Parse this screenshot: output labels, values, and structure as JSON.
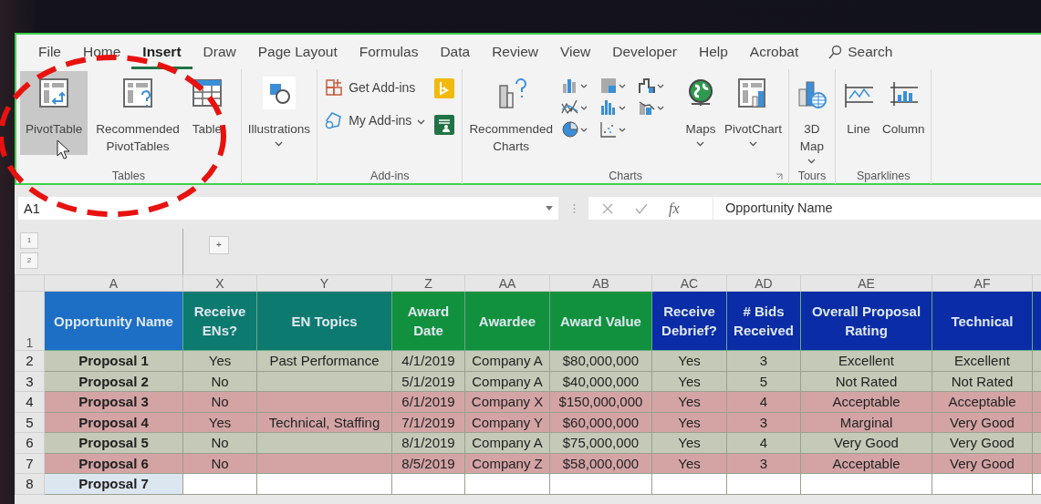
{
  "ribbon": {
    "tabs": [
      {
        "label": "File",
        "selected": false
      },
      {
        "label": "Home",
        "selected": false
      },
      {
        "label": "Insert",
        "selected": true
      },
      {
        "label": "Draw",
        "selected": false
      },
      {
        "label": "Page Layout",
        "selected": false
      },
      {
        "label": "Formulas",
        "selected": false
      },
      {
        "label": "Data",
        "selected": false
      },
      {
        "label": "Review",
        "selected": false
      },
      {
        "label": "View",
        "selected": false
      },
      {
        "label": "Developer",
        "selected": false
      },
      {
        "label": "Help",
        "selected": false
      },
      {
        "label": "Acrobat",
        "selected": false
      }
    ],
    "search": {
      "label": "Search"
    },
    "groups": [
      {
        "label": "Tables",
        "launcher": false,
        "items": [
          {
            "kind": "large",
            "label": "PivotTable",
            "hovered": true,
            "dropdown": false
          },
          {
            "kind": "large",
            "label": "Recommended PivotTables",
            "hovered": false,
            "dropdown": false
          },
          {
            "kind": "large",
            "label": "Table",
            "hovered": false,
            "dropdown": false
          }
        ]
      },
      {
        "launcher": false,
        "items": [
          {
            "kind": "large",
            "label": "Illustrations",
            "hovered": false,
            "dropdown": true
          }
        ]
      },
      {
        "label": "Add-ins",
        "launcher": false,
        "items": [
          {
            "kind": "small",
            "label": "Get Add-ins",
            "dropdown": false
          },
          {
            "kind": "small",
            "label": "My Add-ins",
            "dropdown": true
          },
          {
            "kind": "icons"
          }
        ]
      },
      {
        "label": "Charts",
        "launcher": true,
        "items": [
          {
            "kind": "large",
            "label": "Recommended Charts",
            "hovered": false,
            "dropdown": false
          },
          {
            "kind": "gallery"
          },
          {
            "kind": "large",
            "label": "Maps",
            "hovered": false,
            "dropdown": true
          },
          {
            "kind": "large",
            "label": "PivotChart",
            "hovered": false,
            "dropdown": true
          }
        ]
      },
      {
        "label": "Tours",
        "launcher": false,
        "items": [
          {
            "kind": "large",
            "label": "3D Map",
            "hovered": false,
            "dropdown": true
          }
        ]
      },
      {
        "label": "Sparklines",
        "launcher": false,
        "items": [
          {
            "kind": "large",
            "label": "Line",
            "hovered": false,
            "dropdown": false
          },
          {
            "kind": "large",
            "label": "Column",
            "hovered": false,
            "dropdown": false
          }
        ]
      }
    ]
  },
  "formula_bar": {
    "name_box": "A1",
    "function_label": "fx",
    "formula": "Opportunity Name"
  },
  "outline": {
    "levels": [
      "1",
      "2"
    ],
    "expand_button": "+"
  },
  "sheet": {
    "columns": [
      {
        "letter": "A",
        "heading": "Opportunity Name",
        "color": "#1c6fc4"
      },
      {
        "letter": "X",
        "heading": "Receive ENs?",
        "color": "#0d7a70"
      },
      {
        "letter": "Y",
        "heading": "EN Topics",
        "color": "#0d7a70"
      },
      {
        "letter": "Z",
        "heading": "Award Date",
        "color": "#11913e"
      },
      {
        "letter": "AA",
        "heading": "Awardee",
        "color": "#11913e"
      },
      {
        "letter": "AB",
        "heading": "Award Value",
        "color": "#11913e"
      },
      {
        "letter": "AC",
        "heading": "Receive Debrief?",
        "color": "#0a2ca6"
      },
      {
        "letter": "AD",
        "heading": "# Bids Received",
        "color": "#0a2ca6"
      },
      {
        "letter": "AE",
        "heading": "Overall Proposal Rating",
        "color": "#0a2ca6"
      },
      {
        "letter": "AF",
        "heading": "Technical",
        "color": "#0a2ca6"
      }
    ],
    "header_row": "1",
    "rows": [
      {
        "number": "2",
        "color": "#c4cab7",
        "cells": [
          "Proposal 1",
          "Yes",
          "Past Performance",
          "4/1/2019",
          "Company A",
          "$80,000,000",
          "Yes",
          "3",
          "Excellent",
          "Excellent"
        ]
      },
      {
        "number": "3",
        "color": "#c4cab7",
        "cells": [
          "Proposal 2",
          "No",
          "",
          "5/1/2019",
          "Company A",
          "$40,000,000",
          "Yes",
          "5",
          "Not Rated",
          "Not Rated"
        ]
      },
      {
        "number": "4",
        "color": "#d4a4a5",
        "cells": [
          "Proposal 3",
          "No",
          "",
          "6/1/2019",
          "Company X",
          "$150,000,000",
          "Yes",
          "4",
          "Acceptable",
          "Acceptable"
        ]
      },
      {
        "number": "5",
        "color": "#d4a4a5",
        "cells": [
          "Proposal 4",
          "Yes",
          "Technical, Staffing",
          "7/1/2019",
          "Company Y",
          "$60,000,000",
          "Yes",
          "3",
          "Marginal",
          "Very Good"
        ]
      },
      {
        "number": "6",
        "color": "#c4cab7",
        "cells": [
          "Proposal 5",
          "No",
          "",
          "8/1/2019",
          "Company A",
          "$75,000,000",
          "Yes",
          "4",
          "Very Good",
          "Very Good"
        ]
      },
      {
        "number": "7",
        "color": "#d4a4a5",
        "cells": [
          "Proposal 6",
          "No",
          "",
          "8/5/2019",
          "Company Z",
          "$58,000,000",
          "Yes",
          "3",
          "Acceptable",
          "Very Good"
        ]
      },
      {
        "number": "8",
        "color": "#dce6f1",
        "cells": [
          "Proposal 7"
        ]
      }
    ]
  }
}
